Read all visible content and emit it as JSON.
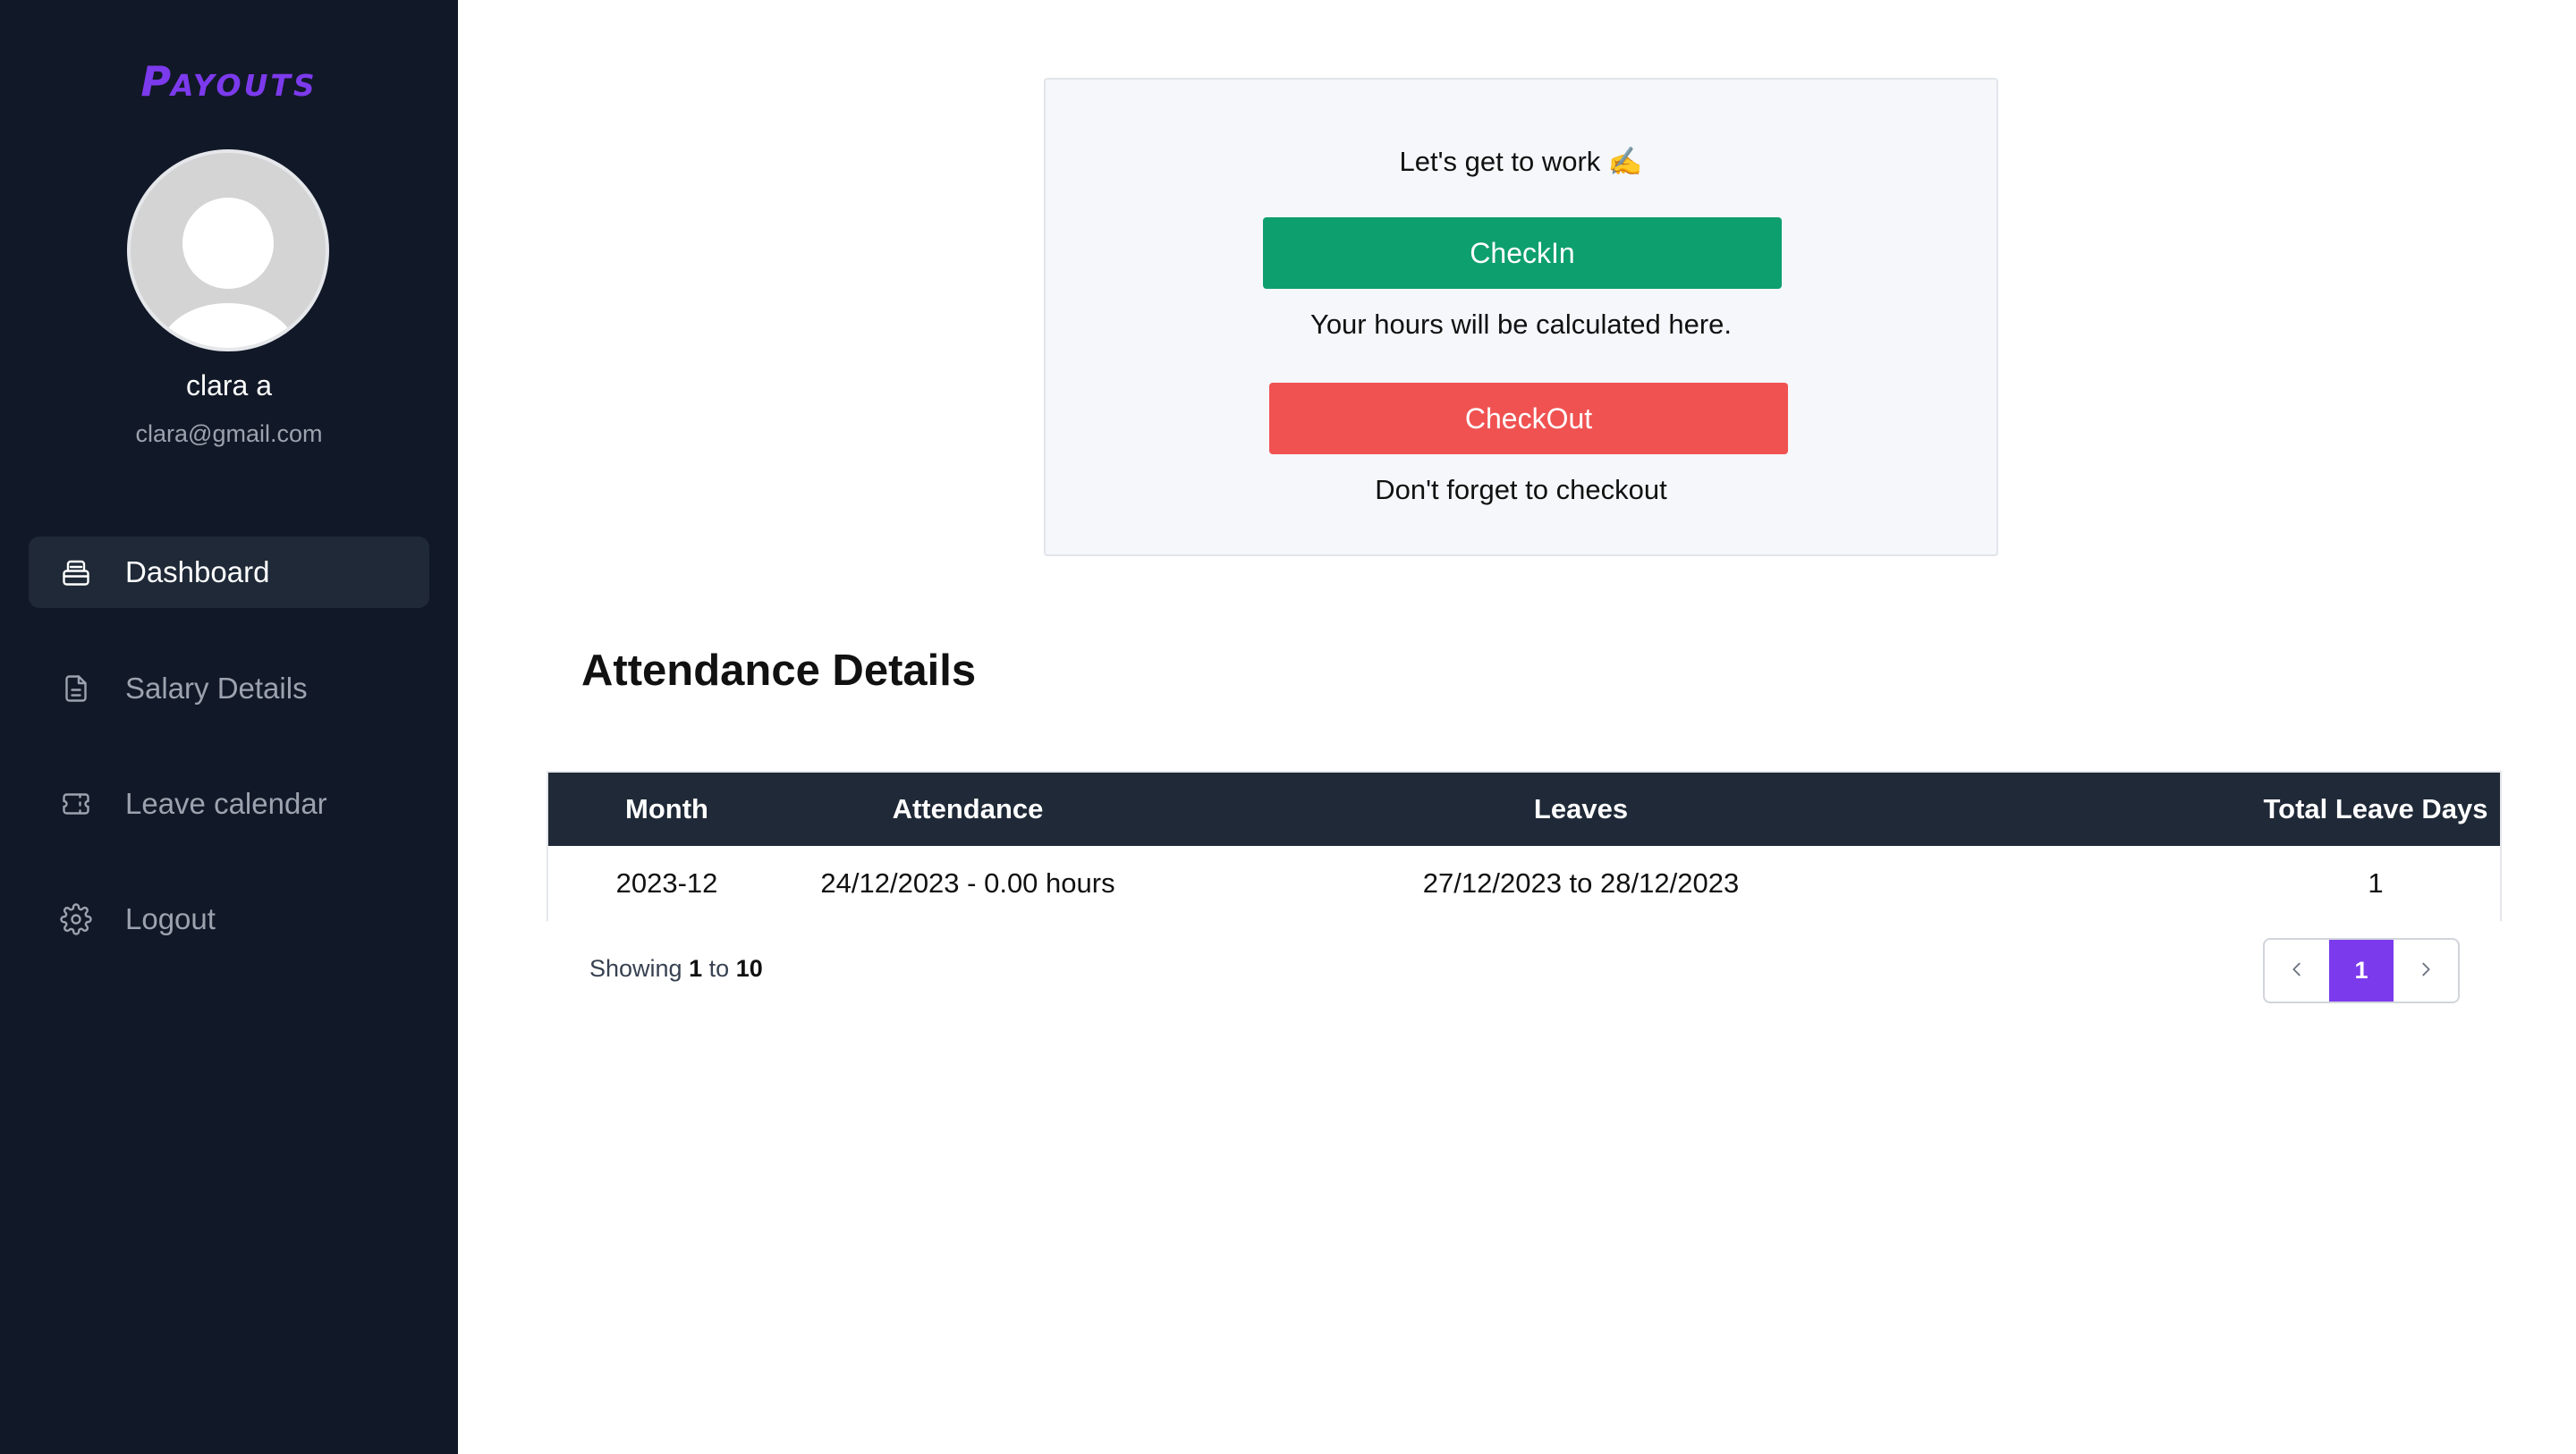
{
  "brand": {
    "logo_big": "P",
    "logo_rest": "AYOUTS",
    "accent_color": "#7c3aed"
  },
  "user": {
    "name": "clara a",
    "email": "clara@gmail.com"
  },
  "sidebar": {
    "items": [
      {
        "label": "Dashboard",
        "icon": "inbox-icon",
        "active": true
      },
      {
        "label": "Salary Details",
        "icon": "document-icon",
        "active": false
      },
      {
        "label": "Leave calendar",
        "icon": "ticket-icon",
        "active": false
      },
      {
        "label": "Logout",
        "icon": "gear-icon",
        "active": false
      }
    ]
  },
  "checkin_card": {
    "greeting": "Let's get to work ✍️",
    "checkin_label": "CheckIn",
    "checkin_note": "Your hours will be calculated here.",
    "checkout_label": "CheckOut",
    "checkout_note": "Don't forget to checkout",
    "checkin_color": "#0e9f6e",
    "checkout_color": "#f05252"
  },
  "attendance": {
    "title": "Attendance Details",
    "columns": [
      "Month",
      "Attendance",
      "Leaves",
      "Total Leave Days"
    ],
    "rows": [
      [
        "2023-12",
        "24/12/2023 - 0.00 hours",
        "27/12/2023 to 28/12/2023",
        "1"
      ]
    ],
    "header_color": "#1f2937"
  },
  "pagination": {
    "showing_prefix": "Showing",
    "from": "1",
    "to_word": "to",
    "to": "10",
    "prev_icon": "chevron-left-icon",
    "current_page": "1",
    "next_icon": "chevron-right-icon"
  }
}
